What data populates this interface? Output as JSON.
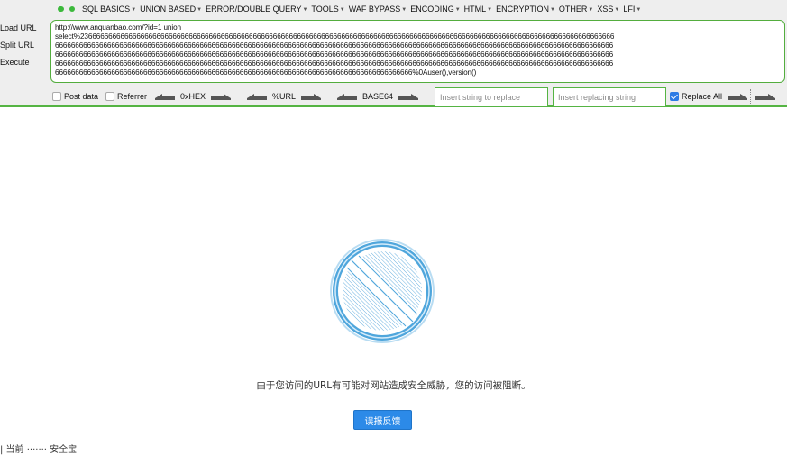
{
  "hackbar": {
    "menu": [
      {
        "label": "SQL BASICS"
      },
      {
        "label": "UNION BASED"
      },
      {
        "label": "ERROR/DOUBLE QUERY"
      },
      {
        "label": "TOOLS"
      },
      {
        "label": "WAF BYPASS"
      },
      {
        "label": "ENCODING"
      },
      {
        "label": "HTML"
      },
      {
        "label": "ENCRYPTION"
      },
      {
        "label": "OTHER"
      },
      {
        "label": "XSS"
      },
      {
        "label": "LFI"
      }
    ],
    "side": {
      "load_url": "Load URL",
      "split_url": "Split URL",
      "execute": "Execute"
    },
    "url_lines": [
      "http://www.anquanbao.com/?id=1 union",
      "select%2366666666666666666666666666666666666666666666666666666666666666666666666666666666666666666666666666666666666666666666666666666666666",
      "6666666666666666666666666666666666666666666666666666666666666666666666666666666666666666666666666666666666666666666666666666666666666666666",
      "6666666666666666666666666666666666666666666666666666666666666666666666666666666666666666666666666666666666666666666666666666666666666666666",
      "6666666666666666666666666666666666666666666666666666666666666666666666666666666666666666666666666666666666666666666666666666666666666666666",
      "66666666666666666666666666666666666666666666666666666666666666666666666666666666666666666%0Auser(),version()"
    ],
    "controls": {
      "post_data": "Post data",
      "referrer": "Referrer",
      "hex": "0xHEX",
      "url": "%URL",
      "base64": "BASE64",
      "replace_placeholder": "Insert string to replace",
      "replacing_placeholder": "Insert replacing string",
      "replace_all": "Replace All"
    }
  },
  "blocked": {
    "message": "由于您访问的URL有可能对网站造成安全威胁，您的访问被阻断。",
    "feedback_button": "误报反馈",
    "bottom_text": "| 当前 ······· 安全宝"
  },
  "colors": {
    "accent_green": "#55b443",
    "button_blue": "#2c8ae8",
    "icon_blue": "#4fa6dc"
  }
}
